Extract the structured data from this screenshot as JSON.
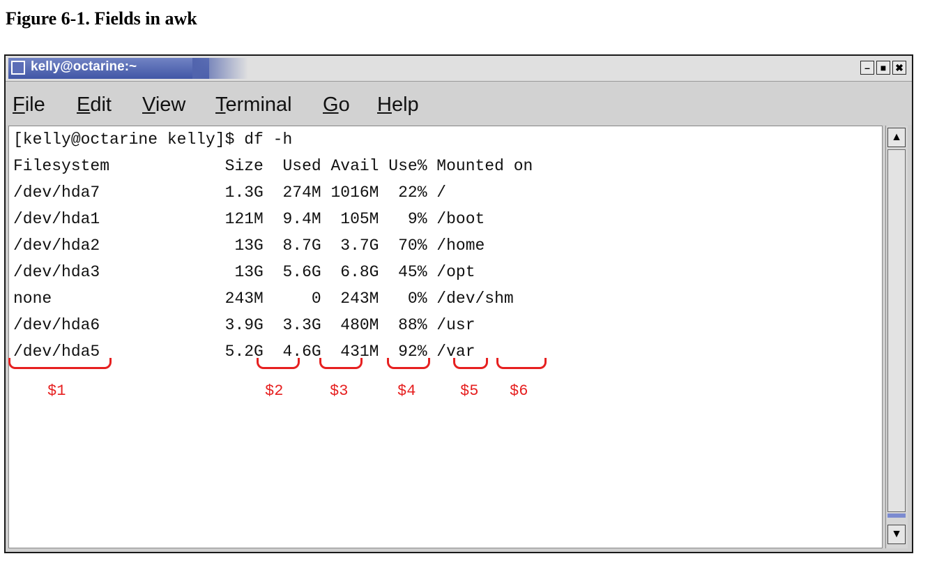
{
  "caption": "Figure 6-1. Fields in awk",
  "window": {
    "title": "kelly@octarine:~",
    "buttons": {
      "minimize": "–",
      "maximize": "■",
      "close": "✖"
    }
  },
  "menu": [
    {
      "u": "F",
      "rest": "ile"
    },
    {
      "u": "E",
      "rest": "dit"
    },
    {
      "u": "V",
      "rest": "iew"
    },
    {
      "u": "T",
      "rest": "erminal"
    },
    {
      "u": "G",
      "rest": "o"
    },
    {
      "u": "H",
      "rest": "elp"
    }
  ],
  "terminal": {
    "lines": [
      "[kelly@octarine kelly]$ df -h",
      "Filesystem            Size  Used Avail Use% Mounted on",
      "/dev/hda7             1.3G  274M 1016M  22% /",
      "/dev/hda1             121M  9.4M  105M   9% /boot",
      "/dev/hda2              13G  8.7G  3.7G  70% /home",
      "/dev/hda3              13G  5.6G  6.8G  45% /opt",
      "none                  243M     0  243M   0% /dev/shm",
      "/dev/hda6             3.9G  3.3G  480M  88% /usr",
      "/dev/hda5             5.2G  4.6G  431M  92% /var"
    ]
  },
  "fields": [
    "$1",
    "$2",
    "$3",
    "$4",
    "$5",
    "$6"
  ],
  "scrollbar": {
    "up": "▲",
    "down": "▼"
  },
  "colors": {
    "annotation": "#e62020",
    "titlebar": "#4156a6"
  }
}
